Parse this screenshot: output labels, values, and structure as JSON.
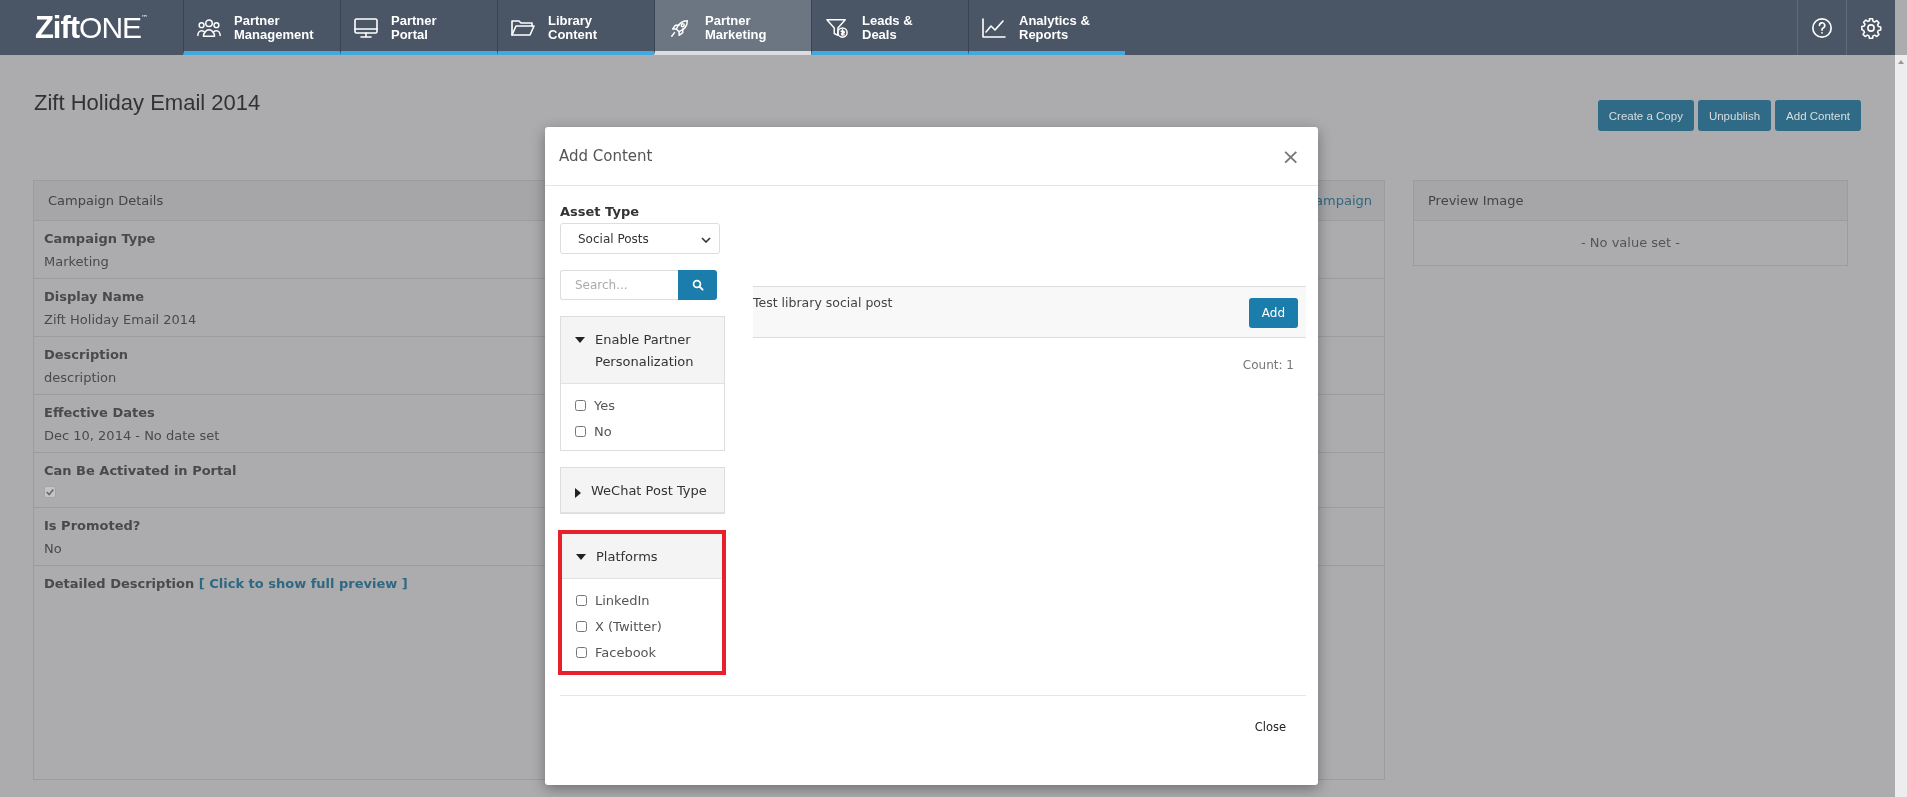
{
  "nav": {
    "logo": {
      "main": "Zift",
      "accent": "ONE",
      "mark": "™"
    },
    "tabs": [
      {
        "label": "Partner Management",
        "selected": false
      },
      {
        "label": "Partner Portal",
        "selected": false
      },
      {
        "label": "Library Content",
        "selected": false
      },
      {
        "label": "Partner Marketing",
        "selected": true
      },
      {
        "label": "Leads & Deals",
        "selected": false
      },
      {
        "label": "Analytics & Reports",
        "selected": false
      }
    ]
  },
  "page": {
    "title": "Zift Holiday Email 2014",
    "actions": [
      "Create a Copy",
      "Unpublish",
      "Add Content"
    ],
    "details": {
      "header": "Campaign Details",
      "link": "ampaign",
      "fields": [
        {
          "kind": "text",
          "label": "Campaign Type",
          "value": "Marketing"
        },
        {
          "kind": "text",
          "label": "Display Name",
          "value": "Zift Holiday Email 2014"
        },
        {
          "kind": "text",
          "label": "Description",
          "value": "description"
        },
        {
          "kind": "text",
          "label": "Effective Dates",
          "value": "Dec 10, 2014 - No date set"
        },
        {
          "kind": "checkbox",
          "label": "Can Be Activated in Portal",
          "checked": true
        },
        {
          "kind": "text",
          "label": "Is Promoted?",
          "value": "No"
        },
        {
          "kind": "link",
          "label": "Detailed Description",
          "value": "[ Click to show full preview ]"
        }
      ]
    },
    "preview": {
      "header": "Preview Image",
      "value": "- No value set -"
    }
  },
  "modal": {
    "title": "Add Content",
    "close": "×",
    "asset_type": {
      "label": "Asset Type",
      "value": "Social Posts"
    },
    "search": {
      "placeholder": "Search..."
    },
    "filters": [
      {
        "title": "Enable Partner Personalization",
        "expanded": true,
        "highlighted": false,
        "options": [
          {
            "label": "Yes",
            "checked": false
          },
          {
            "label": "No",
            "checked": false
          }
        ]
      },
      {
        "title": "WeChat Post Type",
        "expanded": false,
        "highlighted": false
      },
      {
        "title": "Platforms",
        "expanded": true,
        "highlighted": true,
        "options": [
          {
            "label": "LinkedIn",
            "checked": false
          },
          {
            "label": "X (Twitter)",
            "checked": false
          },
          {
            "label": "Facebook",
            "checked": false
          }
        ]
      }
    ],
    "results": [
      {
        "title": "Test library social post",
        "action": "Add"
      }
    ],
    "count": "Count: 1",
    "footer_button": "Close"
  }
}
